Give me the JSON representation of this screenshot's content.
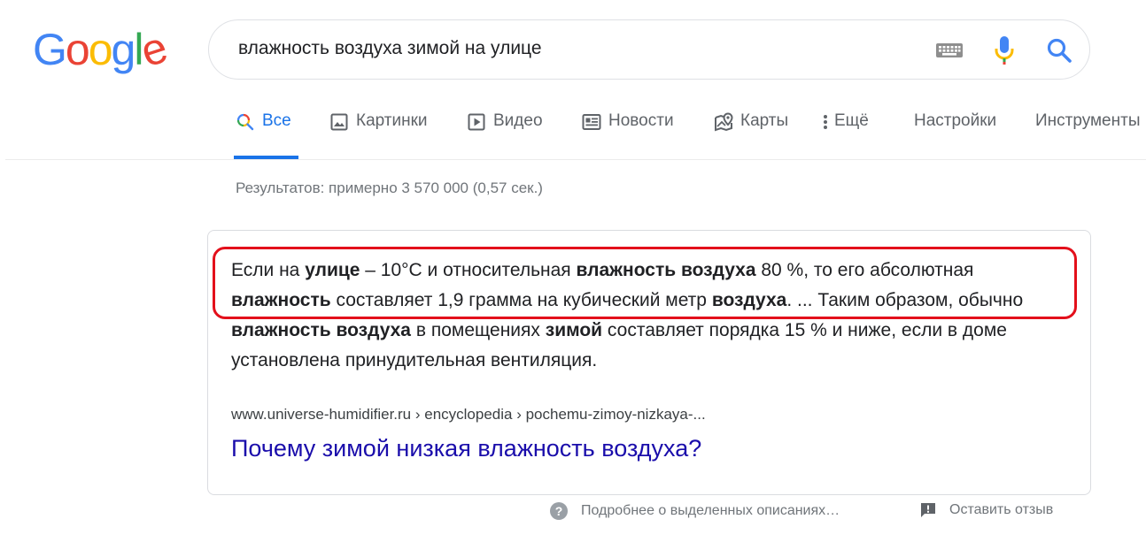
{
  "logo": {
    "letters": [
      "G",
      "o",
      "o",
      "g",
      "l",
      "e"
    ]
  },
  "colors": {
    "blue": "#4285f4",
    "red": "#ea4335",
    "yellow": "#fbbc05",
    "green": "#34a853",
    "link": "#1a0dab",
    "highlight_border": "#e3101b"
  },
  "search": {
    "query": "влажность воздуха зимой на улице",
    "icons": [
      "keyboard-icon",
      "microphone-icon",
      "search-icon"
    ]
  },
  "tabs": [
    {
      "label": "Все",
      "icon": "search-icon",
      "active": true
    },
    {
      "label": "Картинки",
      "icon": "image-icon"
    },
    {
      "label": "Видео",
      "icon": "video-icon"
    },
    {
      "label": "Новости",
      "icon": "news-icon"
    },
    {
      "label": "Карты",
      "icon": "map-icon"
    },
    {
      "label": "Ещё",
      "icon": "more-vert-icon"
    },
    {
      "label": "Настройки"
    },
    {
      "label": "Инструменты"
    }
  ],
  "stats": "Результатов: примерно 3 570 000 (0,57 сек.)",
  "snippet": {
    "parts": [
      {
        "t": "Если на "
      },
      {
        "t": "улице",
        "b": true
      },
      {
        "t": " – 10°C и относительная "
      },
      {
        "t": "влажность воздуха",
        "b": true
      },
      {
        "t": " 80 %, то его абсолютная "
      },
      {
        "t": "влажность",
        "b": true
      },
      {
        "t": " составляет 1,9 грамма на кубический метр "
      },
      {
        "t": "воздуха",
        "b": true
      },
      {
        "t": ". ... Таким образом, обычно "
      },
      {
        "t": "влажность воздуха",
        "b": true
      },
      {
        "t": " в помещениях "
      },
      {
        "t": "зимой",
        "b": true
      },
      {
        "t": " составляет порядка 15 % и ниже, если в доме установлена принудительная вентиляция."
      }
    ],
    "cite": "www.universe-humidifier.ru › encyclopedia › pochemu-zimoy-nizkaya-...",
    "title": "Почему зимой низкая влажность воздуха?"
  },
  "footer": {
    "about": "Подробнее о выделенных описаниях…",
    "feedback": "Оставить отзыв"
  }
}
